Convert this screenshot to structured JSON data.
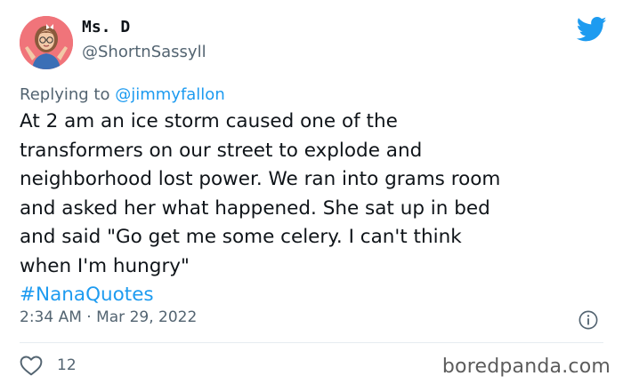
{
  "author": {
    "display_name": "Ms. D",
    "handle": "@ShortnSassyll",
    "avatar_icon": "bitmoji-avatar"
  },
  "reply": {
    "prefix": "Replying to",
    "mention": "@jimmyfallon"
  },
  "tweet": {
    "lines": [
      "At 2 am an ice storm caused one of the",
      "transformers on our street to explode and",
      "neighborhood lost power. We ran into grams room",
      "and asked her what happened. She sat up in bed",
      "and said \"Go get me some celery. I can't think",
      "when I'm hungry\""
    ],
    "hashtag": "#NanaQuotes"
  },
  "meta": {
    "timestamp": "2:34 AM · Mar 29, 2022"
  },
  "actions": {
    "like_count": "12"
  },
  "watermark": "boredpanda.com",
  "colors": {
    "accent": "#1d9bf0",
    "secondary_text": "#536471",
    "avatar_bg": "#f0747a"
  }
}
